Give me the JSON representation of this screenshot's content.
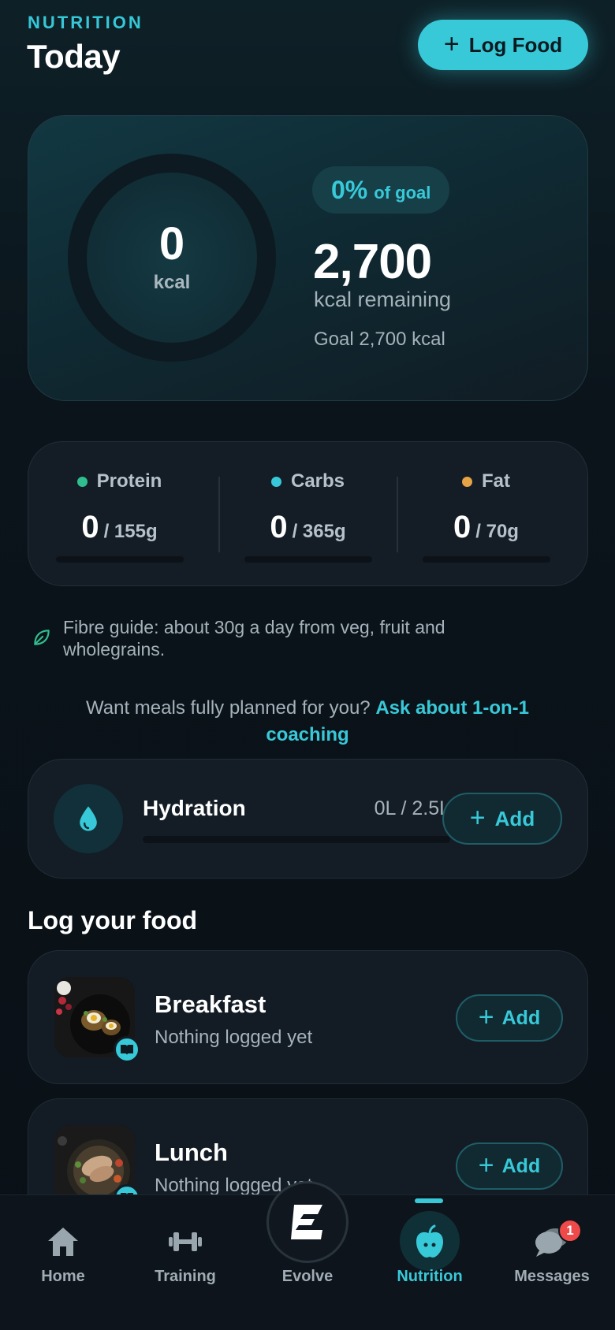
{
  "header": {
    "eyebrow": "NUTRITION",
    "title": "Today",
    "log_food_label": "Log Food"
  },
  "calories": {
    "consumed": "0",
    "unit": "kcal",
    "percent_of_goal": 0,
    "percent_label": "0%",
    "of_goal_label": "of goal",
    "remaining_value": "2,700",
    "remaining_label": "kcal remaining",
    "goal_label": "Goal 2,700 kcal"
  },
  "macros": [
    {
      "name": "Protein",
      "value": "0",
      "target": "/ 155g",
      "color": "#2fbf8f",
      "progress": 0
    },
    {
      "name": "Carbs",
      "value": "0",
      "target": "/ 365g",
      "color": "#38c9d8",
      "progress": 0
    },
    {
      "name": "Fat",
      "value": "0",
      "target": "/ 70g",
      "color": "#e6a447",
      "progress": 0
    }
  ],
  "fibre_tip": "Fibre guide: about 30g a day from veg, fruit and wholegrains.",
  "coaching": {
    "prompt": "Want meals fully planned for you?",
    "link": "Ask about 1-on-1 coaching"
  },
  "hydration": {
    "title": "Hydration",
    "amount": "0L / 2.5L",
    "progress": 0,
    "add_label": "Add"
  },
  "log_section": {
    "title": "Log your food",
    "meals": [
      {
        "name": "Breakfast",
        "status": "Nothing logged yet",
        "add_label": "Add"
      },
      {
        "name": "Lunch",
        "status": "Nothing logged yet",
        "add_label": "Add"
      }
    ]
  },
  "nav": {
    "items": [
      {
        "label": "Home",
        "icon": "home-icon"
      },
      {
        "label": "Training",
        "icon": "dumbbell-icon"
      },
      {
        "label": "Evolve",
        "icon": "evolve-logo-icon"
      },
      {
        "label": "Nutrition",
        "icon": "apple-icon"
      },
      {
        "label": "Messages",
        "icon": "chat-icon"
      }
    ],
    "active": "Nutrition",
    "messages_badge": "1"
  },
  "colors": {
    "accent": "#38c9d8",
    "background": "#0b1117",
    "card": "#141d26",
    "badge": "#ee4a4a"
  }
}
